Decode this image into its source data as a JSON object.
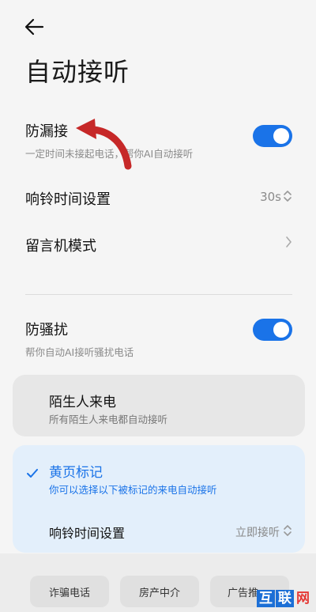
{
  "page": {
    "title": "自动接听"
  },
  "leak": {
    "title": "防漏接",
    "subtitle": "一定时间未接起电话，帮你AI自动接听",
    "enabled": true
  },
  "ring": {
    "label": "响铃时间设置",
    "value": "30s"
  },
  "voicemail": {
    "label": "留言机模式"
  },
  "harass": {
    "title": "防骚扰",
    "subtitle": "帮你自动AI接听骚扰电话",
    "enabled": true
  },
  "stranger": {
    "title": "陌生人来电",
    "subtitle": "所有陌生人来电都自动接听"
  },
  "yellow": {
    "title": "黄页标记",
    "subtitle": "你可以选择以下被标记的来电自动接听",
    "ring_label": "响铃时间设置",
    "ring_value": "立即接听",
    "selected": true
  },
  "tags": [
    "诈骗电话",
    "房产中介",
    "广告推"
  ],
  "watermark": {
    "chars": [
      "互",
      "联",
      "网"
    ]
  },
  "colors": {
    "accent": "#1a73e8",
    "selected_card": "#e3effb",
    "annotation_arrow": "#d32f2f"
  }
}
